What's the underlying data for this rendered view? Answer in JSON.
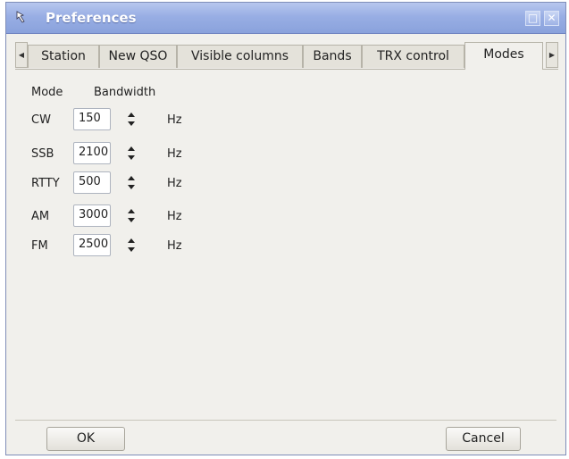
{
  "window": {
    "title": "Preferences",
    "icon": "app-icon",
    "controls": {
      "maximize": "□",
      "close": "✕"
    }
  },
  "tabs": [
    {
      "label": "Station",
      "active": false
    },
    {
      "label": "New QSO",
      "active": false
    },
    {
      "label": "Visible columns",
      "active": false
    },
    {
      "label": "Bands",
      "active": false
    },
    {
      "label": "TRX control",
      "active": false
    },
    {
      "label": "Modes",
      "active": true
    }
  ],
  "modes_panel": {
    "header_mode": "Mode",
    "header_bandwidth": "Bandwidth",
    "rows": [
      {
        "mode": "CW",
        "bandwidth": "150",
        "unit": "Hz"
      },
      {
        "mode": "SSB",
        "bandwidth": "2100",
        "unit": "Hz"
      },
      {
        "mode": "RTTY",
        "bandwidth": "500",
        "unit": "Hz"
      },
      {
        "mode": "AM",
        "bandwidth": "3000",
        "unit": "Hz"
      },
      {
        "mode": "FM",
        "bandwidth": "2500",
        "unit": "Hz"
      }
    ]
  },
  "buttons": {
    "ok": "OK",
    "cancel": "Cancel"
  },
  "colors": {
    "titlebar": "#98aee4",
    "window_bg": "#f1f0ec"
  }
}
